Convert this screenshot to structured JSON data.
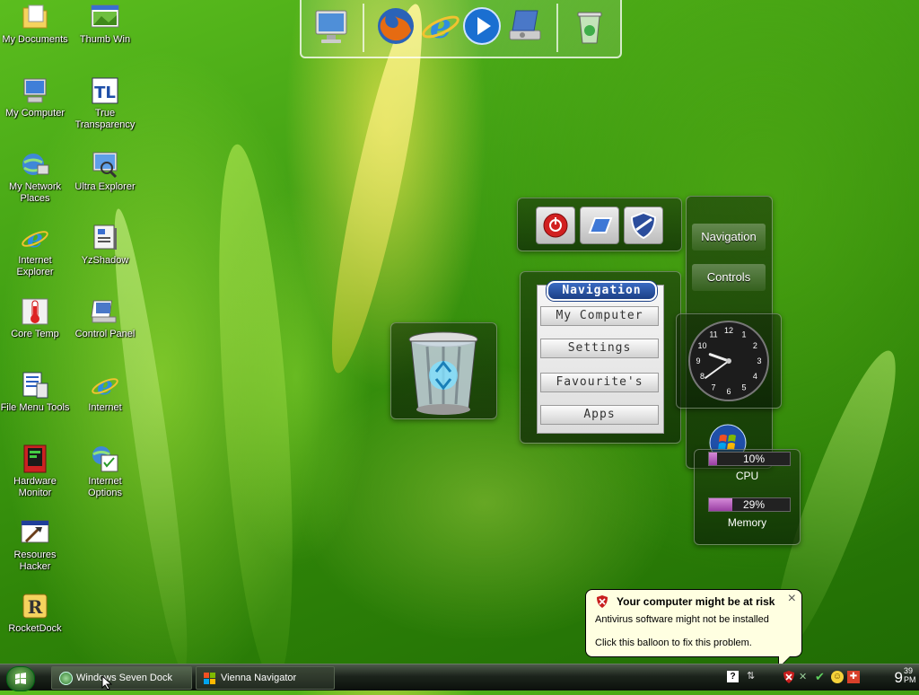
{
  "desktop": {
    "icons": [
      {
        "label": "My Documents",
        "icon": "folder-documents-icon"
      },
      {
        "label": "Thumb Win",
        "icon": "thumbnail-window-icon"
      },
      {
        "label": "My Computer",
        "icon": "my-computer-icon"
      },
      {
        "label": "True Transparency",
        "icon": "true-transparency-icon"
      },
      {
        "label": "My Network Places",
        "icon": "network-places-icon"
      },
      {
        "label": "Ultra Explorer",
        "icon": "ultra-explorer-icon"
      },
      {
        "label": "Internet Explorer",
        "icon": "internet-explorer-icon"
      },
      {
        "label": "YzShadow",
        "icon": "yzshadow-icon"
      },
      {
        "label": "Core Temp",
        "icon": "thermometer-icon"
      },
      {
        "label": "Control Panel",
        "icon": "control-panel-icon"
      },
      {
        "label": "File Menu Tools",
        "icon": "file-menu-tools-icon"
      },
      {
        "label": "Internet",
        "icon": "internet-icon"
      },
      {
        "label": "Hardware Monitor",
        "icon": "hardware-monitor-icon"
      },
      {
        "label": "Internet Options",
        "icon": "internet-options-icon"
      },
      {
        "label": "Resoures Hacker",
        "icon": "resource-hacker-icon"
      },
      {
        "label": "RocketDock",
        "icon": "rocketdock-icon"
      }
    ]
  },
  "top_dock": {
    "items": [
      "monitor-icon",
      "firefox-icon",
      "internet-explorer-icon",
      "media-player-icon",
      "system-properties-icon",
      "recycle-bin-icon"
    ]
  },
  "navigation_panel": {
    "title": "Navigation",
    "buttons": [
      "My Computer",
      "Settings",
      "Favourite's",
      "Apps"
    ]
  },
  "side_panel": {
    "buttons": [
      "Navigation",
      "Controls"
    ]
  },
  "clock_widget": {
    "numerals": [
      "12",
      "1",
      "2",
      "3",
      "4",
      "5",
      "6",
      "7",
      "8",
      "9",
      "10",
      "11"
    ],
    "hours": 9,
    "minutes": 39
  },
  "system_monitor": {
    "cpu_label": "CPU",
    "cpu_percent": "10%",
    "cpu_value": 0.1,
    "memory_label": "Memory",
    "memory_percent": "29%",
    "memory_value": 0.29
  },
  "balloon": {
    "title": "Your computer might be at risk",
    "line1": "Antivirus software might not be installed",
    "line2": "Click this balloon to fix this problem.",
    "close": "×"
  },
  "taskbar": {
    "tasks": [
      {
        "label": "Windows Seven Dock",
        "active": true
      },
      {
        "label": "Vienna Navigator",
        "active": false
      }
    ],
    "clock_hour": "9",
    "clock_minutes": "39",
    "clock_ampm": "PM"
  },
  "colors": {
    "accent_green": "#3f9d12",
    "nav_title_blue": "#1c3f86",
    "balloon_bg": "#ffffe1",
    "memory_bar": "#9a3fa3"
  }
}
